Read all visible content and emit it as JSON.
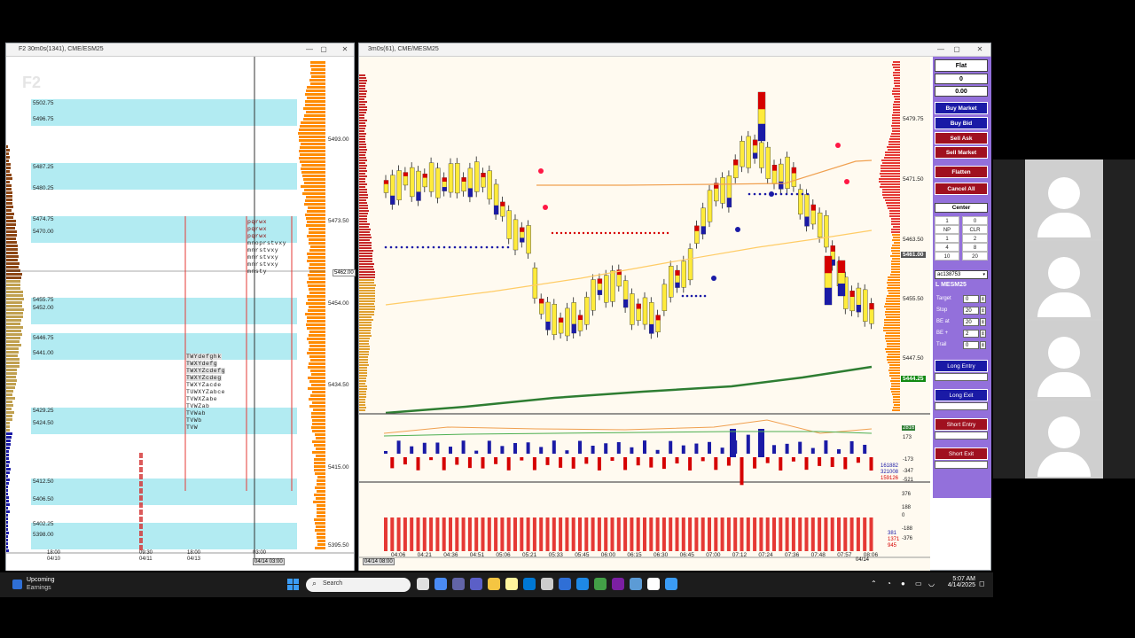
{
  "left_chart": {
    "title": "F2 30m0s(1341), CME/ESM25",
    "watermark": "F2",
    "price_labels": [
      "5493.00",
      "5473.50",
      "5454.00",
      "5434.50",
      "5415.00",
      "5395.50"
    ],
    "current_price": "5462.00",
    "zone_labels": [
      "5502.75",
      "5496.75",
      "5487.25",
      "5480.25",
      "5474.75",
      "5470.00",
      "5455.75",
      "5452.00",
      "5446.75",
      "5441.00",
      "5429.25",
      "5424.50",
      "5412.50",
      "5406.50",
      "5402.25",
      "5398.00"
    ],
    "time_labels": [
      [
        "18:00",
        "04/10"
      ],
      [
        "09:30",
        "04/11"
      ],
      [
        "18:00",
        "04/13"
      ],
      [
        "03:00",
        ""
      ]
    ],
    "cursor_time": "04/14 03:00",
    "profile_rows": [
      "pqrwx",
      "pqrwx",
      "pqrwx",
      "mnoprstvxy",
      "mnrstvxy",
      "mnrstvxy",
      "mnrstvxy",
      "mnsty",
      "TWYdefghk",
      "TWXYdefg",
      "TWXYZcdefg",
      "TWXYZcdeg",
      "TWXYZacde",
      "TUWXYZabce",
      "TVWXZabe",
      "TVWZab",
      "TVWab",
      "TVWb",
      "TVW"
    ]
  },
  "main_chart": {
    "title": "3m0s(61), CME/MESM25",
    "price_labels": [
      "5479.75",
      "5471.50",
      "5463.50",
      "5455.50",
      "5447.50"
    ],
    "current_price": "5461.00",
    "green_price": "5444.25",
    "time_labels": [
      "04:06",
      "04:21",
      "04:36",
      "04:51",
      "05:06",
      "05:21",
      "05:33",
      "05:45",
      "06:00",
      "06:15",
      "06:30",
      "06:45",
      "07:00",
      "07:12",
      "07:24",
      "07:36",
      "07:48",
      "07:57",
      "08:06"
    ],
    "time_end_date": "04/14",
    "time_start": "04/14 08:00",
    "ind1_labels": [
      "2816",
      "173",
      "-173",
      "-347",
      "-521"
    ],
    "ind1_values": [
      "161882",
      "321008",
      "159126"
    ],
    "ind2_labels": [
      "376",
      "188",
      "0",
      "-188",
      "-376"
    ],
    "ind2_values": [
      "381",
      "1371",
      "945"
    ]
  },
  "order_panel": {
    "position": "Flat",
    "qty": "0",
    "pnl": "0.00",
    "buy_market": "Buy Market",
    "buy_bid": "Buy Bid",
    "sell_ask": "Sell Ask",
    "sell_market": "Sell Market",
    "flatten": "Flatten",
    "cancel_all": "Cancel All",
    "center": "Center",
    "qty_cells": [
      "1",
      "0",
      "NP",
      "CLR",
      "1",
      "2",
      "4",
      "8",
      "10",
      "20"
    ],
    "account": "ac138753",
    "symbol": "L MESM25",
    "params": [
      {
        "label": "Target",
        "val1": "0",
        "val2": ""
      },
      {
        "label": "Stop",
        "val1": "20",
        "val2": ""
      },
      {
        "label": "BE at",
        "val1": "20",
        "val2": ""
      },
      {
        "label": "BE +",
        "val1": "2",
        "val2": ""
      },
      {
        "label": "Trail",
        "val1": "0",
        "val2": ""
      }
    ],
    "long_entry": "Long Entry",
    "long_exit": "Long Exit",
    "short_entry": "Short Entry",
    "short_exit": "Short Exit"
  },
  "taskbar": {
    "widget_title": "Upcoming",
    "widget_sub": "Earnings",
    "search": "Search",
    "time": "5:07 AM",
    "date": "4/14/2025"
  }
}
